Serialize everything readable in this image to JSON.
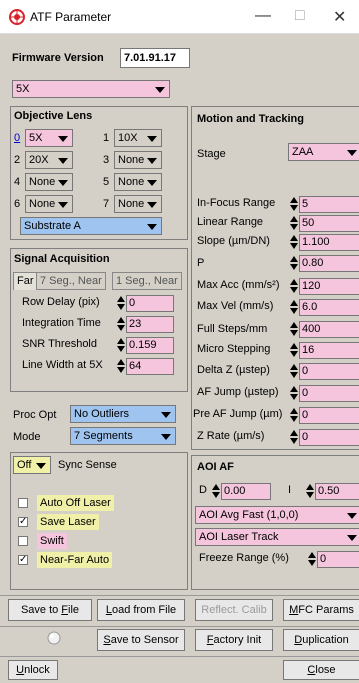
{
  "window": {
    "title": "ATF Parameter",
    "min": "—",
    "max": "□",
    "close": "✕"
  },
  "firmware": {
    "label": "Firmware Version",
    "value": "7.01.91.17"
  },
  "top_select": {
    "value": "5X"
  },
  "objective": {
    "title": "Objective Lens",
    "slots": [
      {
        "num": "0",
        "value": "5X"
      },
      {
        "num": "1",
        "value": "10X"
      },
      {
        "num": "2",
        "value": "20X"
      },
      {
        "num": "3",
        "value": "None"
      },
      {
        "num": "4",
        "value": "None"
      },
      {
        "num": "5",
        "value": "None"
      },
      {
        "num": "6",
        "value": "None"
      },
      {
        "num": "7",
        "value": "None"
      }
    ],
    "substrate": "Substrate A"
  },
  "signal": {
    "title": "Signal Acquisition",
    "tabs": [
      "Far",
      "7 Seg., Near",
      "1 Seg., Near"
    ],
    "rows": [
      {
        "label": "Row Delay (pix)",
        "value": "0"
      },
      {
        "label": "Integration Time",
        "value": "23"
      },
      {
        "label": "SNR Threshold",
        "value": "0.159"
      },
      {
        "label": "Line Width at 5X",
        "value": "64"
      }
    ]
  },
  "proc": {
    "label": "Proc Opt",
    "value": "No Outliers"
  },
  "mode": {
    "label": "Mode",
    "value": "7 Segments"
  },
  "sync": {
    "value": "Off",
    "label": "Sync Sense"
  },
  "checks": [
    {
      "label": "Auto Off Laser",
      "checked": ""
    },
    {
      "label": "Save Laser",
      "checked": "✓"
    },
    {
      "label": "Swift",
      "checked": ""
    },
    {
      "label": "Near-Far Auto",
      "checked": "✓"
    }
  ],
  "motion": {
    "title": "Motion and Tracking",
    "stage_label": "Stage",
    "stage_value": "ZAA",
    "rows": [
      {
        "label": "In-Focus Range",
        "value": "5"
      },
      {
        "label": "Linear Range",
        "value": "50"
      },
      {
        "label": "Slope (µm/DN)",
        "value": "1.100"
      },
      {
        "label": "P",
        "value": "0.80"
      },
      {
        "label": "Max Acc (mm/s²)",
        "value": "120"
      },
      {
        "label": "Max Vel (mm/s)",
        "value": "6.0"
      },
      {
        "label": "Full Steps/mm",
        "value": "400"
      },
      {
        "label": "Micro Stepping",
        "value": "16"
      },
      {
        "label": "Delta Z (µstep)",
        "value": "0"
      },
      {
        "label": "AF Jump (µstep)",
        "value": "0"
      },
      {
        "label": "Pre AF Jump (µm)",
        "value": "0"
      },
      {
        "label": "Z Rate (µm/s)",
        "value": "0"
      }
    ]
  },
  "aoi": {
    "title": "AOI AF",
    "d_label": "D",
    "d_value": "0.00",
    "i_label": "I",
    "i_value": "0.50",
    "avg_fast": "AOI Avg Fast (1,0,0)",
    "laser_track": "AOI Laser Track",
    "freeze_label": "Freeze Range (%)",
    "freeze_value": "0"
  },
  "buttons": {
    "save_file_pre": "Save to ",
    "save_file_u": "F",
    "save_file_post": "ile",
    "load_file_u": "L",
    "load_file_post": "oad from File",
    "reflect": "Reflect. Calib",
    "mfc_u": "M",
    "mfc_post": "FC Params",
    "save_sensor_u": "S",
    "save_sensor_post": "ave to Sensor",
    "factory_u": "F",
    "factory_post": "actory Init",
    "dup_u": "D",
    "dup_post": "uplication",
    "unlock_u": "U",
    "unlock_post": "nlock",
    "close_u": "C",
    "close_post": "lose"
  },
  "colors": {
    "pink": "#f4c5dc",
    "blue": "#9fc4f0",
    "yellow": "#f0f0a8",
    "bg": "#d4d0c8"
  }
}
